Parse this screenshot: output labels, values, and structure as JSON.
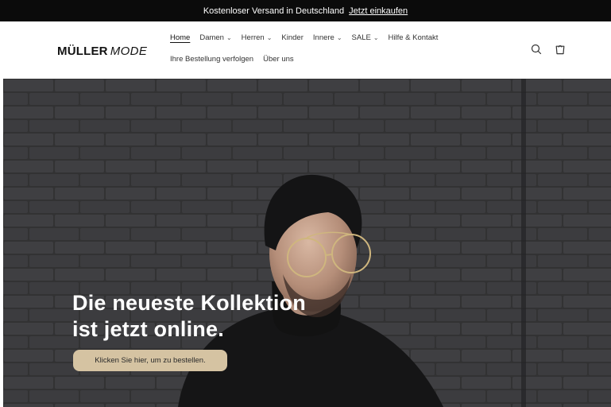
{
  "announcement": {
    "text": "Kostenloser Versand in Deutschland",
    "link": "Jetzt einkaufen"
  },
  "header": {
    "logo_bold": "MÜLLER",
    "logo_light": "MODE",
    "nav_row1": [
      {
        "label": "Home",
        "active": true,
        "has_dropdown": false
      },
      {
        "label": "Damen",
        "has_dropdown": true
      },
      {
        "label": "Herren",
        "has_dropdown": true
      },
      {
        "label": "Kinder",
        "has_dropdown": false
      },
      {
        "label": "Innere",
        "has_dropdown": true
      },
      {
        "label": "SALE",
        "has_dropdown": true
      },
      {
        "label": "Hilfe & Kontakt",
        "has_dropdown": false
      }
    ],
    "nav_row2": [
      {
        "label": "Ihre Bestellung verfolgen"
      },
      {
        "label": "Über uns"
      }
    ],
    "icons": [
      "search-icon",
      "cart-icon"
    ]
  },
  "hero": {
    "title": "Die neueste Kollektion\nist jetzt online.",
    "button_label": "Klicken Sie hier, um zu bestellen.",
    "button_color": "#d5c3a2"
  },
  "colors": {
    "announcement_bg": "#0b0b0b",
    "hero_bg": "#3b3b3d"
  }
}
